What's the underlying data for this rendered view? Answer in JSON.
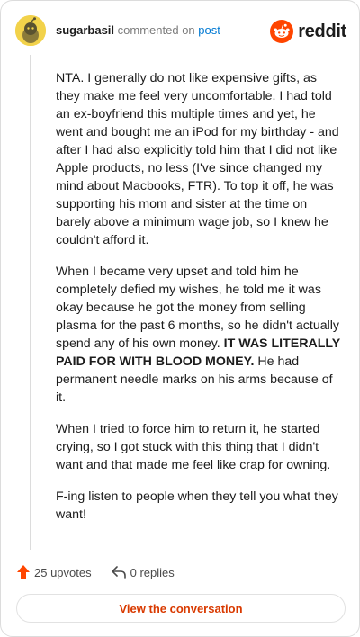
{
  "header": {
    "username": "sugarbasil",
    "action_text": "commented on",
    "post_link": "post",
    "logo_text": "reddit"
  },
  "comment": {
    "paragraph1": "NTA. I generally do not like expensive gifts, as they make me feel very uncomfortable. I had told an ex-boyfriend this multiple times and yet, he went and bought me an iPod for my birthday - and after I had also explicitly told him that I did not like Apple products, no less (I've since changed my mind about Macbooks, FTR). To top it off, he was supporting his mom and sister at the time on barely above a minimum wage job, so I knew he couldn't afford it.",
    "paragraph2_before": "When I became very upset and told him he completely defied my wishes, he told me it was okay because he got the money from selling plasma for the past 6 months, so he didn't actually spend any of his own money. ",
    "paragraph2_bold": "IT WAS LITERALLY PAID FOR WITH BLOOD MONEY.",
    "paragraph2_after": " He had permanent needle marks on his arms because of it.",
    "paragraph3": "When I tried to force him to return it, he started crying, so I got stuck with this thing that I didn't want and that made me feel like crap for owning.",
    "paragraph4": "F-ing listen to people when they tell you what they want!"
  },
  "actions": {
    "upvotes_label": "25 upvotes",
    "replies_label": "0 replies"
  },
  "view_button_label": "View the conversation",
  "colors": {
    "accent": "#d93a00",
    "link": "#0079d3",
    "upvote": "#ff4500",
    "avatar": "#f2d24a"
  },
  "icons": {
    "avatar": "snoo-avatar-icon",
    "logo": "reddit-snoo-icon",
    "upvote": "upvote-arrow-icon",
    "reply": "reply-arrow-icon"
  }
}
